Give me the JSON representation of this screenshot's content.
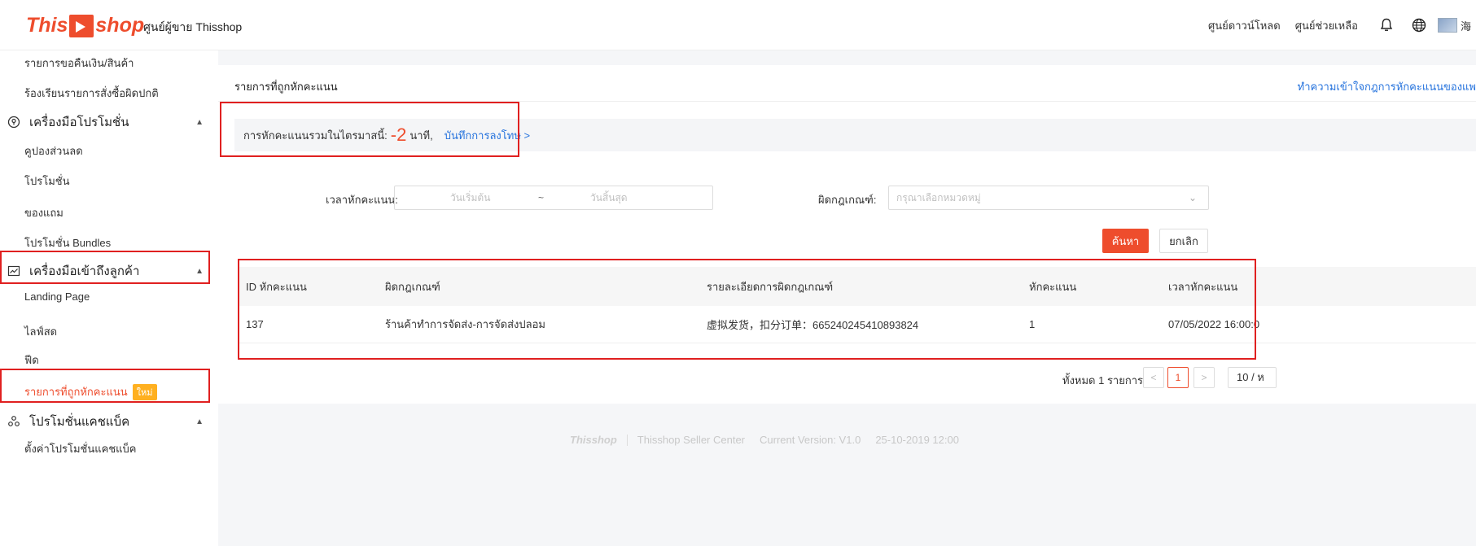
{
  "header": {
    "logo_this": "This",
    "logo_shop": "shop",
    "seller_center": "ศูนย์ผู้ขาย Thisshop",
    "download_center": "ศูนย์ดาวน์โหลด",
    "help_center": "ศูนย์ช่วยเหลือ",
    "user_name": "海"
  },
  "sidebar": {
    "items_top": [
      "รายการขอคืนเงิน/สินค้า",
      "ร้องเรียนรายการสั่งซื้อผิดปกติ"
    ],
    "group_promo": "เครื่องมือโปรโมชั่น",
    "promo_items": [
      "คูปองส่วนลด",
      "โปรโมชั่น",
      "ของแถม",
      "โปรโมชั่น Bundles"
    ],
    "group_customer": "เครื่องมือเข้าถึงลูกค้า",
    "customer_items": [
      "Landing Page",
      "ไลฟ์สด",
      "ฟีด"
    ],
    "active_item": "รายการที่ถูกหักคะแนน",
    "new_badge": "ใหม่",
    "group_cashback": "โปรโมชั่นแคชแบ็ค",
    "cashback_items": [
      "ตั้งค่าโปรโมชั่นแคชแบ็ค"
    ]
  },
  "main": {
    "title": "รายการที่ถูกหักคะแนน",
    "help_link": "ทำความเข้าใจกฎการหักคะแนนของแพ",
    "summary_label": "การหักคะแนนรวมในไตรมาสนี้:",
    "summary_value": "-2",
    "summary_unit": "นาที,",
    "punish_link": "บันทึกการลงโทษ >",
    "filter_time_label": "เวลาหักคะแนน:",
    "start_placeholder": "วันเริ่มต้น",
    "range_sep": "~",
    "end_placeholder": "วันสิ้นสุด",
    "filter_rule_label": "ผิดกฎเกณฑ์:",
    "rule_placeholder": "กรุณาเลือกหมวดหมู่",
    "search_btn": "ค้นหา",
    "cancel_btn": "ยกเลิก"
  },
  "table": {
    "headers": [
      "ID หักคะแนน",
      "ผิดกฎเกณฑ์",
      "รายละเอียดการผิดกฎเกณฑ์",
      "หักคะแนน",
      "เวลาหักคะแนน"
    ],
    "rows": [
      [
        "137",
        "ร้านค้าทำการจัดส่ง-การจัดส่งปลอม",
        "虚拟发货，扣分订单：665240245410893824",
        "1",
        "07/05/2022 16:00:0"
      ]
    ]
  },
  "pagination": {
    "total": "ทั้งหมด 1 รายการ",
    "prev": "<",
    "current": "1",
    "next": ">",
    "page_size": "10 / ห"
  },
  "footer": {
    "logo": "Thisshop",
    "name": "Thisshop Seller Center",
    "version": "Current Version: V1.0",
    "date": "25-10-2019 12:00"
  },
  "colors": {
    "brand": "#ee4d2d",
    "link": "#2673dd",
    "highlight_box": "#e02020"
  }
}
